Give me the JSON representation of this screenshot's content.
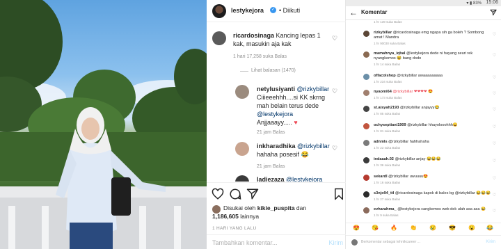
{
  "colors": {
    "link": "#003569",
    "meta": "#8e8e8e",
    "heart_red": "#ed4956",
    "verified": "#3897f0"
  },
  "post": {
    "username": "lestykejora",
    "follow_status": "• Diikuti",
    "comments": [
      {
        "user": "ricardosinaga",
        "text": "Kancing lepas 1 kak, masukin aja kak",
        "meta": "1 hari   17,258 suka   Balas",
        "view_replies": "Lihat balasan (1470)"
      },
      {
        "user": "netylusiyanti",
        "mention": "@rizkybillar",
        "text": "Ciiieeehhh....si KK skrng mah belain terus dede",
        "mention2": "@lestykejora",
        "text2": "Anjjaaayy.....",
        "emoji": "♥",
        "meta": "21 jam   Balas"
      },
      {
        "user": "inkharadhika",
        "mention": "@rizkybillar",
        "text": "hahaha posesif",
        "emoji": "😂",
        "meta": "21 jam   Balas"
      },
      {
        "user": "ladiezaza",
        "mention": "@lestykejora",
        "text": ""
      }
    ],
    "liked_by_prefix": "Disukai oleh",
    "liked_by_user": "kikie_puspita",
    "liked_by_and": "dan",
    "likes_count": "1,186,605",
    "likes_suffix": "lainnya",
    "time_ago": "1 HARI YANG LALU",
    "add_comment_placeholder": "Tambahkan komentar...",
    "send_label": "Kirim"
  },
  "phone": {
    "status_time": "15:06",
    "status_icons": "▾ ▮ 83%",
    "title": "Komentar",
    "comments": [
      {
        "user": "",
        "text": "",
        "meta": "1 hr   139 suka   Balas"
      },
      {
        "user": "rizkybillar",
        "text": "@ricardosinaga emg ngapa sih ga boleh ? Sombong amat ! Mandra",
        "meta": "1 hr   90030 suka   Balas",
        "avatar": "#5b4636"
      },
      {
        "user": "mamahnya_iqbal",
        "text": "@lestykejora dede ni hayang seuri rek nyangkemos 😂 bang dodo",
        "meta": "1 hr   14 suka   Balas",
        "avatar": "#8a6a52"
      },
      {
        "user": "offacolshop",
        "text": "@rizkybillar awaaaaaaaaa",
        "meta": "1 hr   234 suka   Balas",
        "avatar": "#6b8fa8"
      },
      {
        "user": "nyaomi64",
        "text": "@rizkybillar ❤❤❤❤ 😍",
        "meta": "1 hr   173 suka   Balas",
        "avatar": "#a07f6e"
      },
      {
        "user": "st.aisyah2193",
        "text": "@rizkybillar anjayyy😂",
        "meta": "1 hr   85 suka   Balas",
        "avatar": "#444444"
      },
      {
        "user": "ochyseptiani1909",
        "text": "@rizkybillar hhayolooohhh😀",
        "meta": "1 hr   81 suka   Balas",
        "avatar": "#c2553f"
      },
      {
        "user": "adnmls",
        "text": "@rizkybillar hahhahaha",
        "meta": "1 hr   23 suka   Balas",
        "avatar": "#7a7a7a"
      },
      {
        "user": "indaaah.02",
        "text": "@rizkybillar anjay 😂😂😂",
        "meta": "1 hr   36 suka   Balas",
        "avatar": "#3b3b3b"
      },
      {
        "user": "sekardl",
        "text": "@rizkybillar uwuuuu😍",
        "meta": "1 hr   16 suka   Balas",
        "avatar": "#b53a2f"
      },
      {
        "user": "s3njo94_ttl",
        "text": "@ricardosinaga kapok di bales bg @rizkybillar 😂😂😂",
        "meta": "1 hr   27 suka   Balas",
        "avatar": "#2c2c2c"
      },
      {
        "user": "evharahma_",
        "text": "@lestykejora cangkemos web dek ulah asa asa 😂",
        "meta": "1 hr   9 suka   Balas",
        "avatar": "#8b6b5c"
      }
    ],
    "emoji_bar": [
      "😍",
      "😘",
      "🔥",
      "👏",
      "😢",
      "😎",
      "😮",
      "😂"
    ],
    "reply_placeholder": "Berkomentar sebagai tehnikcareer ..."
  }
}
